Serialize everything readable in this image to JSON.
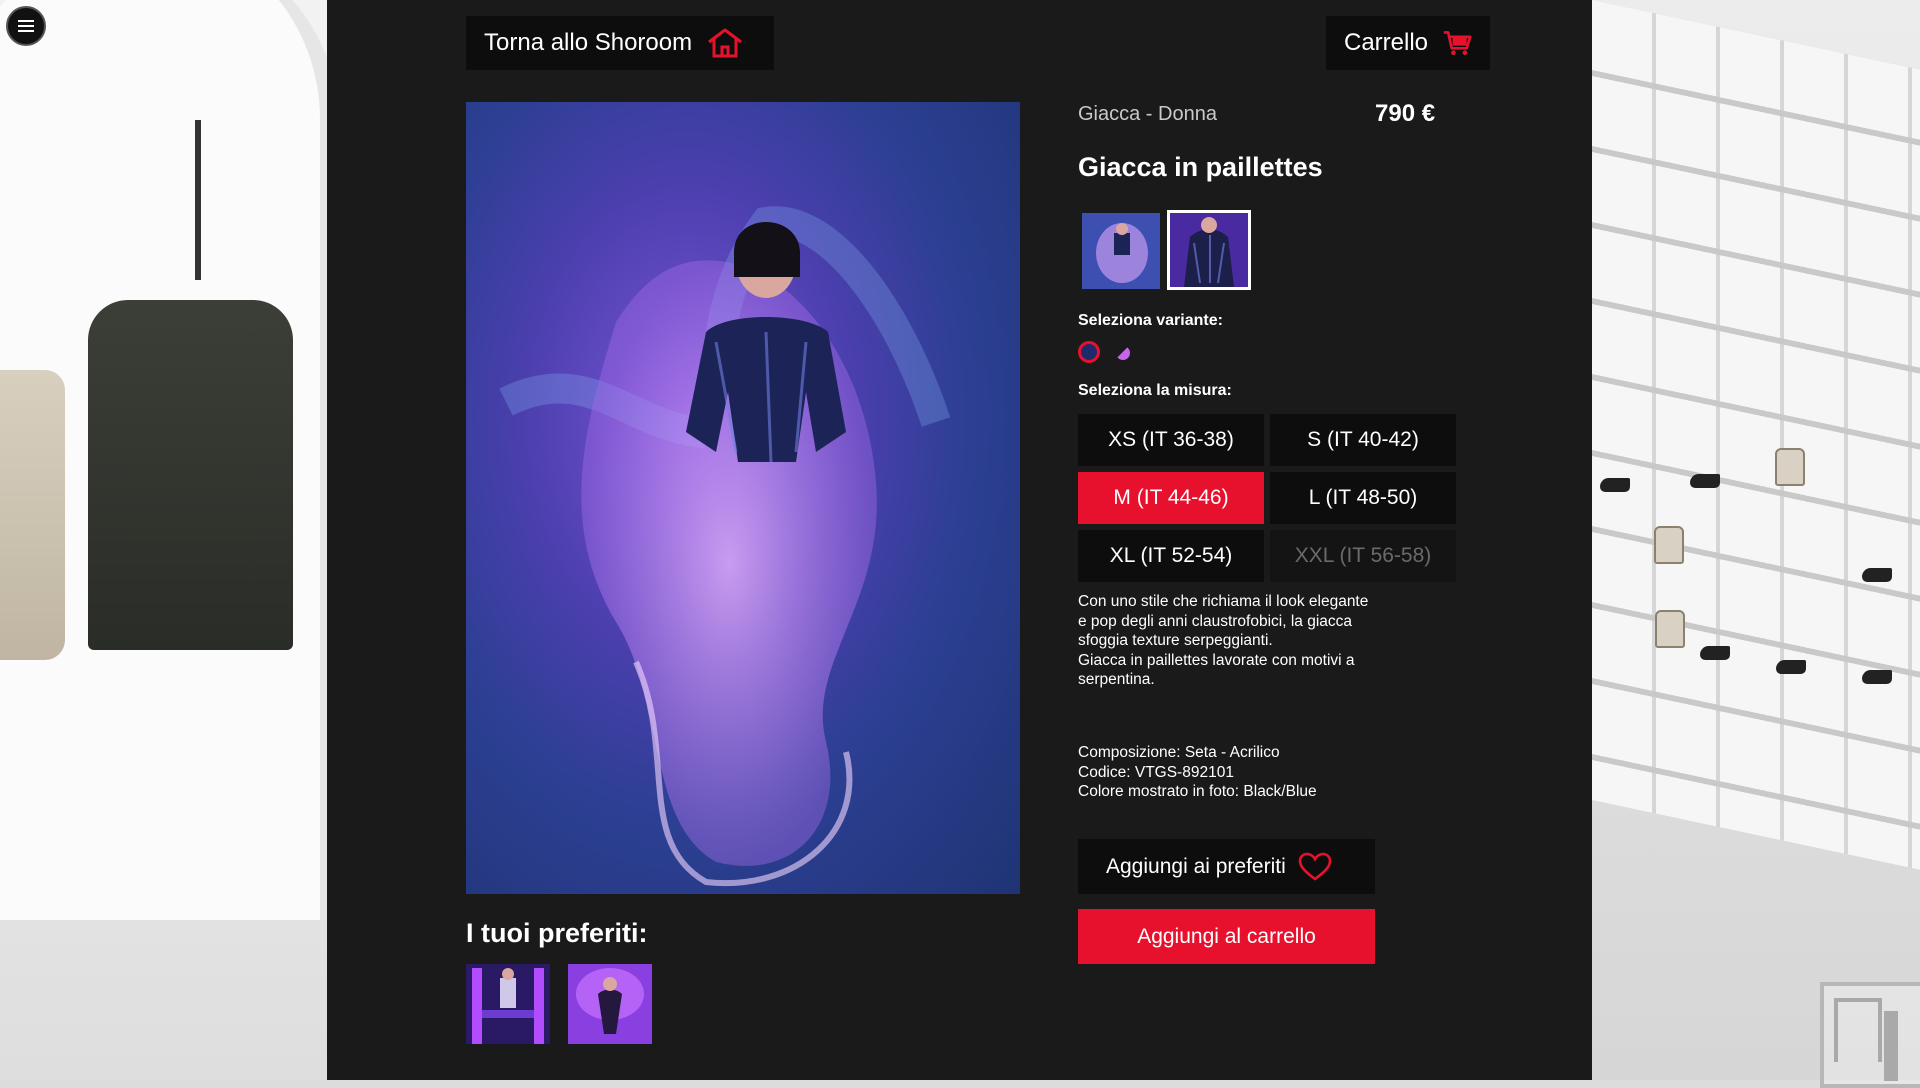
{
  "header": {
    "menu_icon": "hamburger-menu-icon",
    "back_label": "Torna allo Shoroom",
    "back_icon": "home-icon",
    "cart_label": "Carrello",
    "cart_icon": "shopping-cart-icon"
  },
  "product": {
    "category": "Giacca - Donna",
    "price": "790 €",
    "title": "Giacca in paillettes",
    "variant_label": "Seleziona variante:",
    "size_label": "Seleziona la misura:",
    "sizes": [
      {
        "label": "XS (IT 36-38)",
        "state": "available"
      },
      {
        "label": "S (IT 40-42)",
        "state": "available"
      },
      {
        "label": "M (IT 44-46)",
        "state": "selected"
      },
      {
        "label": "L (IT 48-50)",
        "state": "available"
      },
      {
        "label": "XL (IT 52-54)",
        "state": "available"
      },
      {
        "label": "XXL (IT 56-58)",
        "state": "disabled"
      }
    ],
    "description": [
      "Con uno stile che richiama il look elegante",
      "e pop degli anni claustrofobici, la giacca",
      "sfoggia texture serpeggianti.",
      "Giacca in paillettes lavorate con motivi a",
      "serpentina."
    ],
    "composition": "Composizione: Seta - Acrilico",
    "code": "Codice: VTGS-892101",
    "color_shown": "Colore mostrato in foto: Black/Blue",
    "favorite_button": "Aggiungi ai preferiti",
    "favorite_icon": "heart-icon",
    "add_to_cart_button": "Aggiungi al carrello"
  },
  "favorites": {
    "title": "I tuoi preferiti:"
  },
  "colors": {
    "accent": "#e8112d",
    "panel": "#1a1a1a",
    "button": "#0d0d0d"
  }
}
